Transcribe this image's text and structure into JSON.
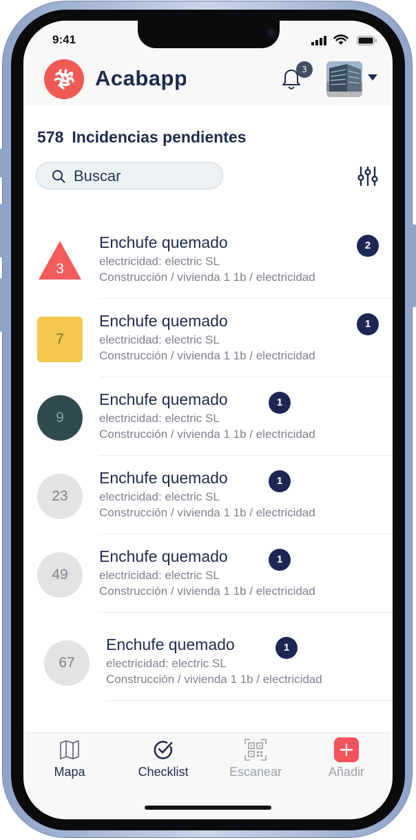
{
  "status_bar": {
    "time": "9:41"
  },
  "header": {
    "app_name": "Acabapp",
    "notifications_count": "3",
    "logo_color": "#ef5a55"
  },
  "summary": {
    "pending_count": "578",
    "pending_label": "Incidencias pendientes"
  },
  "search": {
    "placeholder": "Buscar",
    "value": ""
  },
  "incidents": [
    {
      "id_label": "3",
      "shape": "triangle",
      "color": "#f45b5b",
      "title": "Enchufe quemado",
      "category": "electricidad: electric SL",
      "path": "Construcción / vivienda 1 1b / electricidad",
      "badge": "2"
    },
    {
      "id_label": "7",
      "shape": "square",
      "color": "#f4c94e",
      "title": "Enchufe quemado",
      "category": "electricidad: electric SL",
      "path": "Construcción / vivienda 1 1b / electricidad",
      "badge": "1"
    },
    {
      "id_label": "9",
      "shape": "circle",
      "color": "#2f4b4f",
      "title": "Enchufe quemado",
      "category": "electricidad: electric SL",
      "path": "Construcción / vivienda 1 1b / electricidad",
      "badge": "1"
    },
    {
      "id_label": "23",
      "shape": "circle",
      "color": "#e3e3e3",
      "title": "Enchufe quemado",
      "category": "electricidad: electric SL",
      "path": "Construcción / vivienda 1 1b / electricidad",
      "badge": "1"
    },
    {
      "id_label": "49",
      "shape": "circle",
      "color": "#e3e3e3",
      "title": "Enchufe quemado",
      "category": "electricidad: electric SL",
      "path": "Construcción / vivienda 1 1b / electricidad",
      "badge": "1"
    },
    {
      "id_label": "67",
      "shape": "circle",
      "color": "#e3e3e3",
      "title": "Enchufe quemado",
      "category": "electricidad: electric SL",
      "path": "Construcción / vivienda 1 1b / electricidad",
      "badge": "1"
    }
  ],
  "tabs": [
    {
      "label": "Mapa",
      "icon": "map-icon",
      "state": "normal"
    },
    {
      "label": "Checklist",
      "icon": "check-circle-icon",
      "state": "active"
    },
    {
      "label": "Escanear",
      "icon": "qr-code-icon",
      "state": "disabled"
    },
    {
      "label": "Añadir",
      "icon": "plus-icon",
      "state": "disabled"
    }
  ],
  "colors": {
    "navy": "#1f2a4c",
    "badge": "#1c2753",
    "accent": "#ef5a55",
    "muted": "#7d8290"
  }
}
